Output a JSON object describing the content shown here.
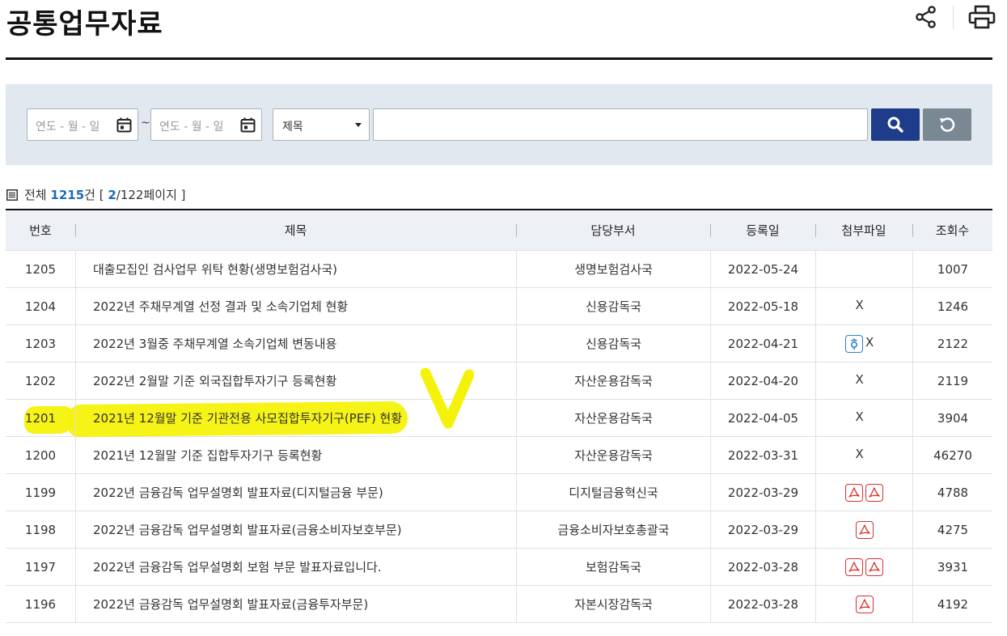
{
  "page": {
    "title": "공통업무자료"
  },
  "icons": {
    "share": "share-icon",
    "print": "print-icon",
    "calendar": "calendar-icon",
    "search": "search-icon",
    "reset": "reset-icon",
    "list": "list-icon"
  },
  "search": {
    "date_from_placeholder": "연도 - 월 - 일",
    "date_to_placeholder": "연도 - 월 - 일",
    "range_separator": "~",
    "field_select_value": "제목",
    "keyword_value": ""
  },
  "summary": {
    "prefix": "전체",
    "total": "1215",
    "unit": "건 [",
    "page_current": "2",
    "page_suffix": "/122페이지 ]"
  },
  "table": {
    "headers": [
      "번호",
      "제목",
      "담당부서",
      "등록일",
      "첨부파일",
      "조회수"
    ],
    "rows": [
      {
        "no": "1205",
        "title": "대출모집인 검사업무 위탁 현황(생명보험검사국)",
        "dept": "생명보험검사국",
        "date": "2022-05-24",
        "files": [],
        "views": "1007"
      },
      {
        "no": "1204",
        "title": "2022년 주채무계열 선정 결과 및 소속기업체 현황",
        "dept": "신용감독국",
        "date": "2022-05-18",
        "files": [
          "excel"
        ],
        "views": "1246"
      },
      {
        "no": "1203",
        "title": "2022년 3월중 주채무계열 소속기업체 변동내용",
        "dept": "신용감독국",
        "date": "2022-04-21",
        "files": [
          "hwp",
          "excel"
        ],
        "views": "2122"
      },
      {
        "no": "1202",
        "title": "2022년 2월말 기준 외국집합투자기구 등록현황",
        "dept": "자산운용감독국",
        "date": "2022-04-20",
        "files": [
          "excel"
        ],
        "views": "2119"
      },
      {
        "no": "1201",
        "title": "2021년 12월말 기준 기관전용 사모집합투자기구(PEF) 현황",
        "dept": "자산운용감독국",
        "date": "2022-04-05",
        "files": [
          "excel"
        ],
        "views": "3904"
      },
      {
        "no": "1200",
        "title": "2021년 12월말 기준 집합투자기구 등록현황",
        "dept": "자산운용감독국",
        "date": "2022-03-31",
        "files": [
          "excel"
        ],
        "views": "46270"
      },
      {
        "no": "1199",
        "title": "2022년 금융감독 업무설명회 발표자료(디지털금융 부문)",
        "dept": "디지털금융혁신국",
        "date": "2022-03-29",
        "files": [
          "pdf",
          "pdf"
        ],
        "views": "4788"
      },
      {
        "no": "1198",
        "title": "2022년 금융감독 업무설명회 발표자료(금융소비자보호부문)",
        "dept": "금융소비자보호총괄국",
        "date": "2022-03-29",
        "files": [
          "pdf"
        ],
        "views": "4275"
      },
      {
        "no": "1197",
        "title": "2022년 금융감독 업무설명회 보험 부문 발표자료입니다.",
        "dept": "보험감독국",
        "date": "2022-03-28",
        "files": [
          "pdf",
          "pdf"
        ],
        "views": "3931"
      },
      {
        "no": "1196",
        "title": "2022년 금융감독 업무설명회 발표자료(금융투자부문)",
        "dept": "자본시장감독국",
        "date": "2022-03-28",
        "files": [
          "pdf"
        ],
        "views": "4192"
      }
    ]
  },
  "colors": {
    "accent_blue": "#1f3c8a",
    "reset_gray": "#7a8894",
    "search_bg": "#e2e8f0",
    "highlighter": "#f5f20a",
    "excel_green": "#1a7a3c",
    "pdf_red": "#d9302e",
    "hwp_blue": "#2a7fcf"
  }
}
